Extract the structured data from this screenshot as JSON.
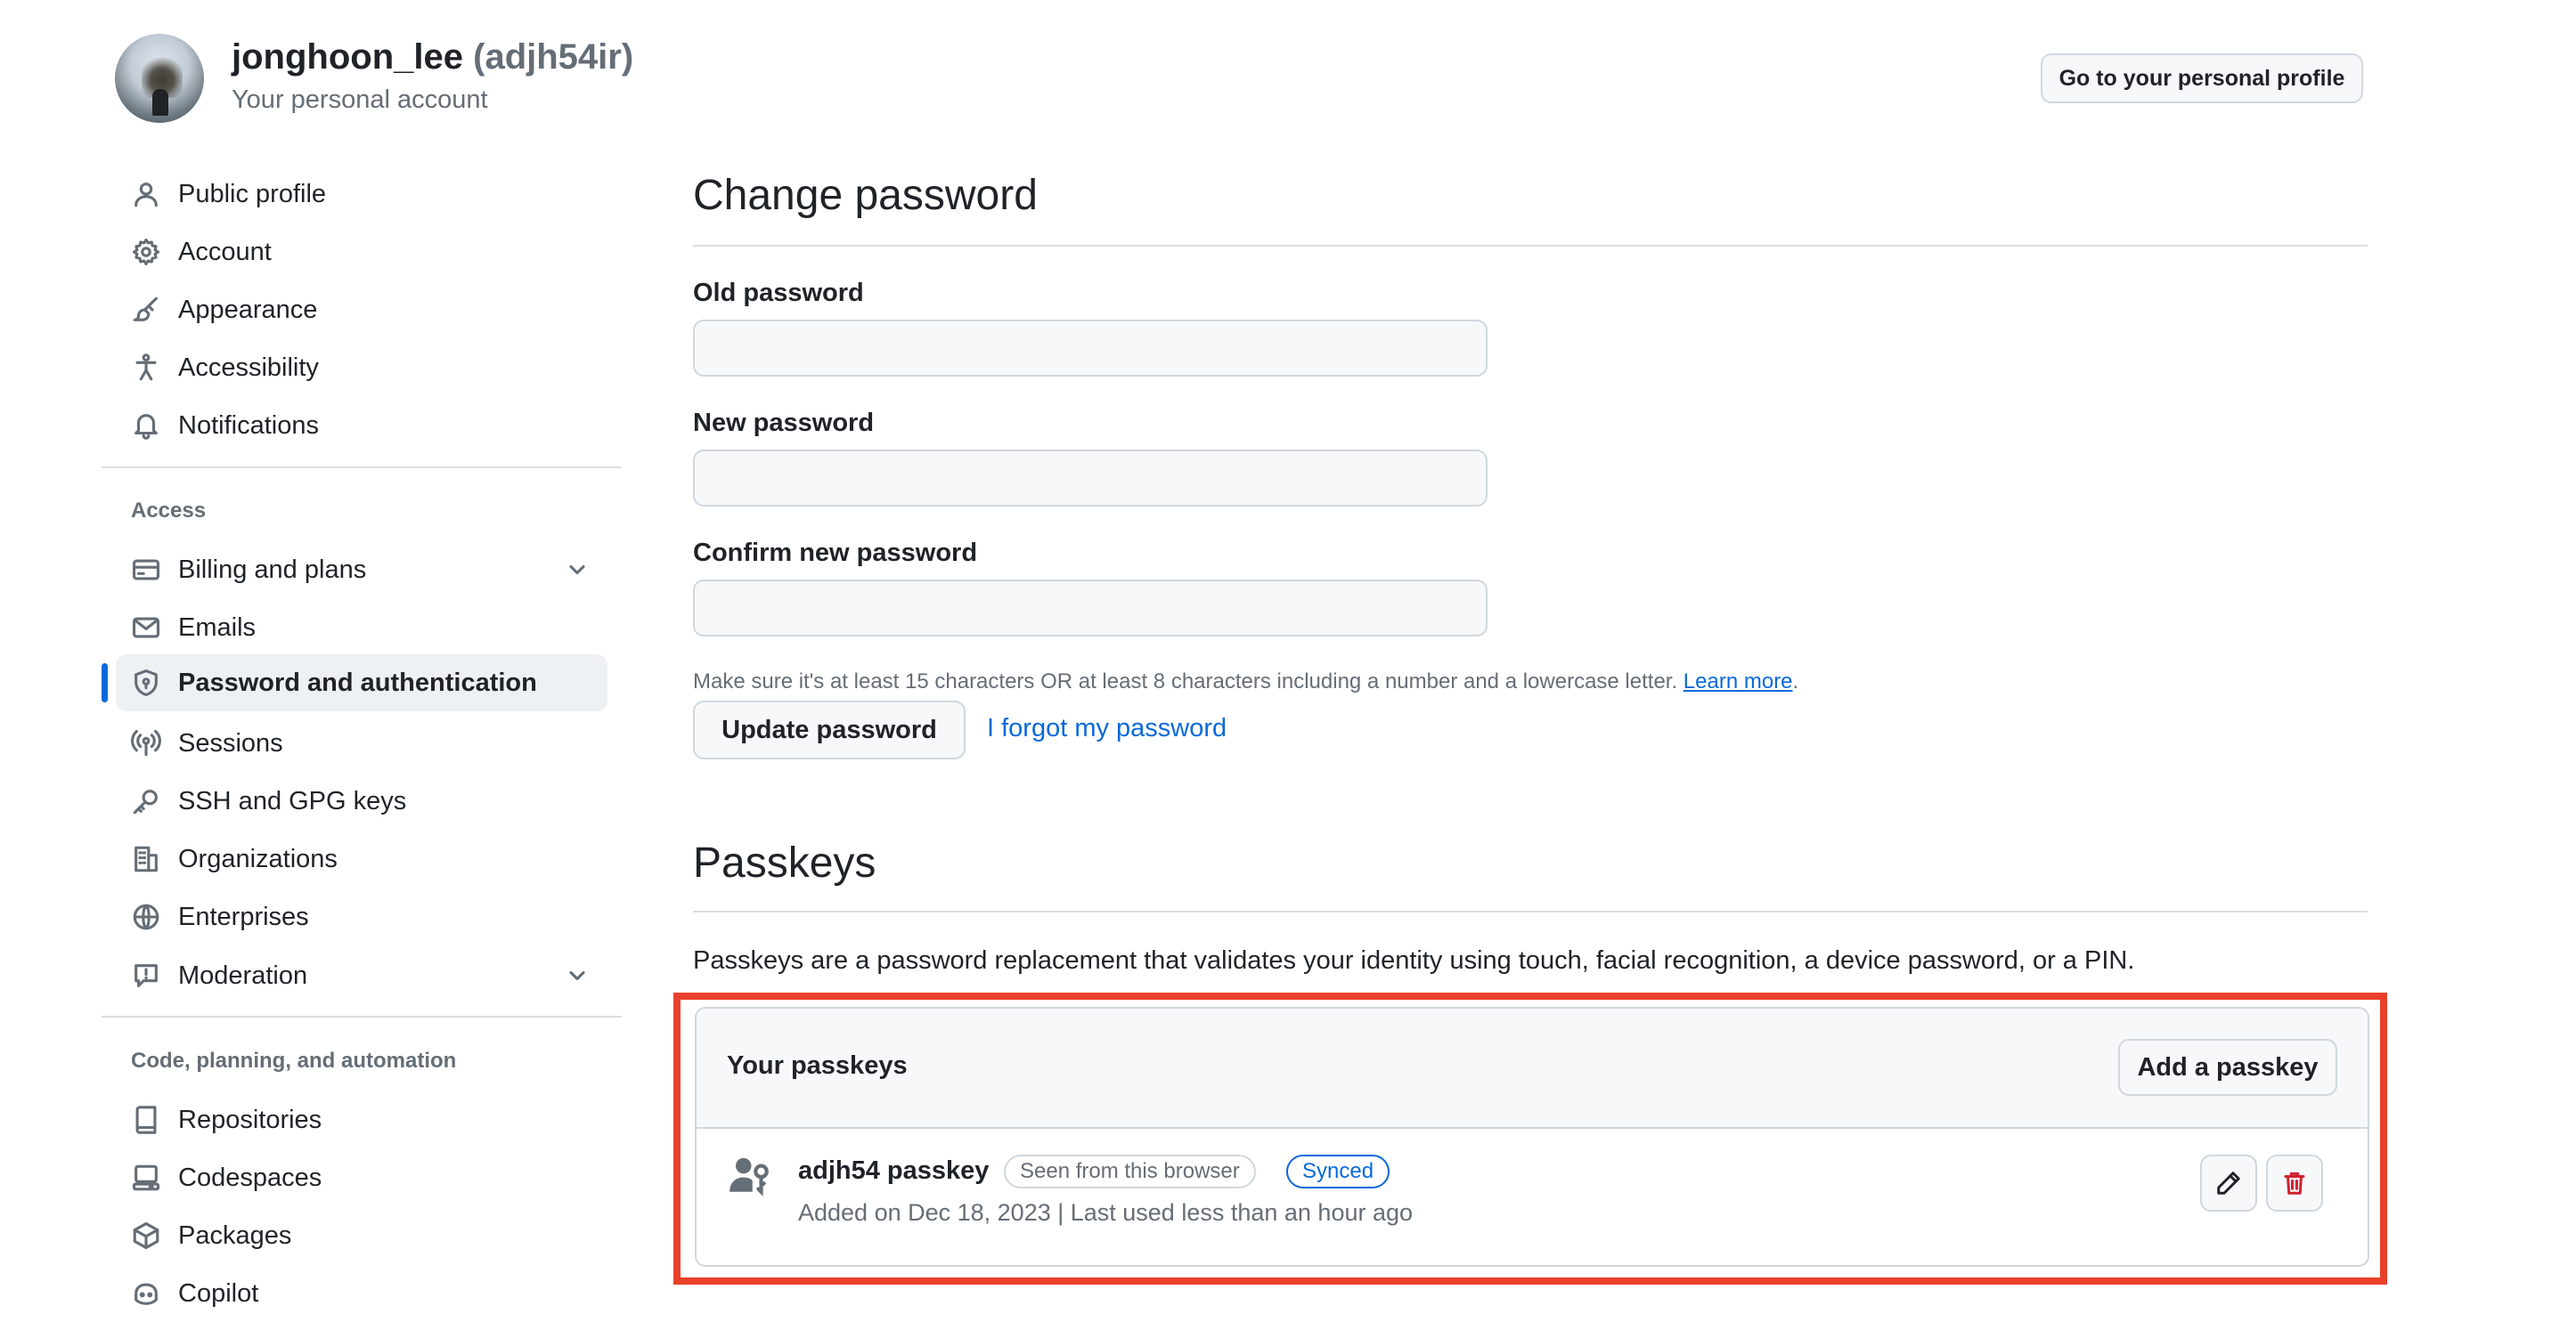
{
  "header": {
    "username": "jonghoon_lee",
    "handle": "(adjh54ir)",
    "subtitle": "Your personal account",
    "profile_button": "Go to your personal profile"
  },
  "sidebar": {
    "items": [
      {
        "label": "Public profile",
        "icon": "person-icon"
      },
      {
        "label": "Account",
        "icon": "gear-icon"
      },
      {
        "label": "Appearance",
        "icon": "paintbrush-icon"
      },
      {
        "label": "Accessibility",
        "icon": "accessibility-icon"
      },
      {
        "label": "Notifications",
        "icon": "bell-icon"
      }
    ],
    "access_heading": "Access",
    "access_items": [
      {
        "label": "Billing and plans",
        "icon": "credit-card-icon"
      },
      {
        "label": "Emails",
        "icon": "mail-icon"
      },
      {
        "label": "Password and authentication",
        "icon": "shield-lock-icon",
        "active": true
      },
      {
        "label": "Sessions",
        "icon": "broadcast-icon"
      },
      {
        "label": "SSH and GPG keys",
        "icon": "key-icon"
      },
      {
        "label": "Organizations",
        "icon": "organization-icon"
      },
      {
        "label": "Enterprises",
        "icon": "globe-icon"
      },
      {
        "label": "Moderation",
        "icon": "report-icon"
      }
    ],
    "code_heading": "Code, planning, and automation",
    "code_items": [
      {
        "label": "Repositories",
        "icon": "repo-icon"
      },
      {
        "label": "Codespaces",
        "icon": "codespaces-icon"
      },
      {
        "label": "Packages",
        "icon": "package-icon"
      },
      {
        "label": "Copilot",
        "icon": "copilot-icon"
      }
    ]
  },
  "password": {
    "title": "Change password",
    "old_label": "Old password",
    "old_value": "",
    "new_label": "New password",
    "new_value": "",
    "confirm_label": "Confirm new password",
    "confirm_value": "",
    "note": "Make sure it's at least 15 characters OR at least 8 characters including a number and a lowercase letter.",
    "learn_more": "Learn more",
    "note_end": ".",
    "update_button": "Update password",
    "forgot_link": "I forgot my password"
  },
  "passkeys": {
    "title": "Passkeys",
    "description": "Passkeys are a password replacement that validates your identity using touch, facial recognition, a device password, or a PIN.",
    "box_title": "Your passkeys",
    "add_button": "Add a passkey",
    "items": [
      {
        "name": "adjh54 passkey",
        "badge_seen": "Seen from this browser",
        "badge_synced": "Synced",
        "meta": "Added on Dec 18, 2023 | Last used less than an hour ago"
      }
    ]
  },
  "colors": {
    "accent": "#0969da",
    "highlight": "#e8402a",
    "muted": "#656d76",
    "danger": "#cf222e"
  }
}
